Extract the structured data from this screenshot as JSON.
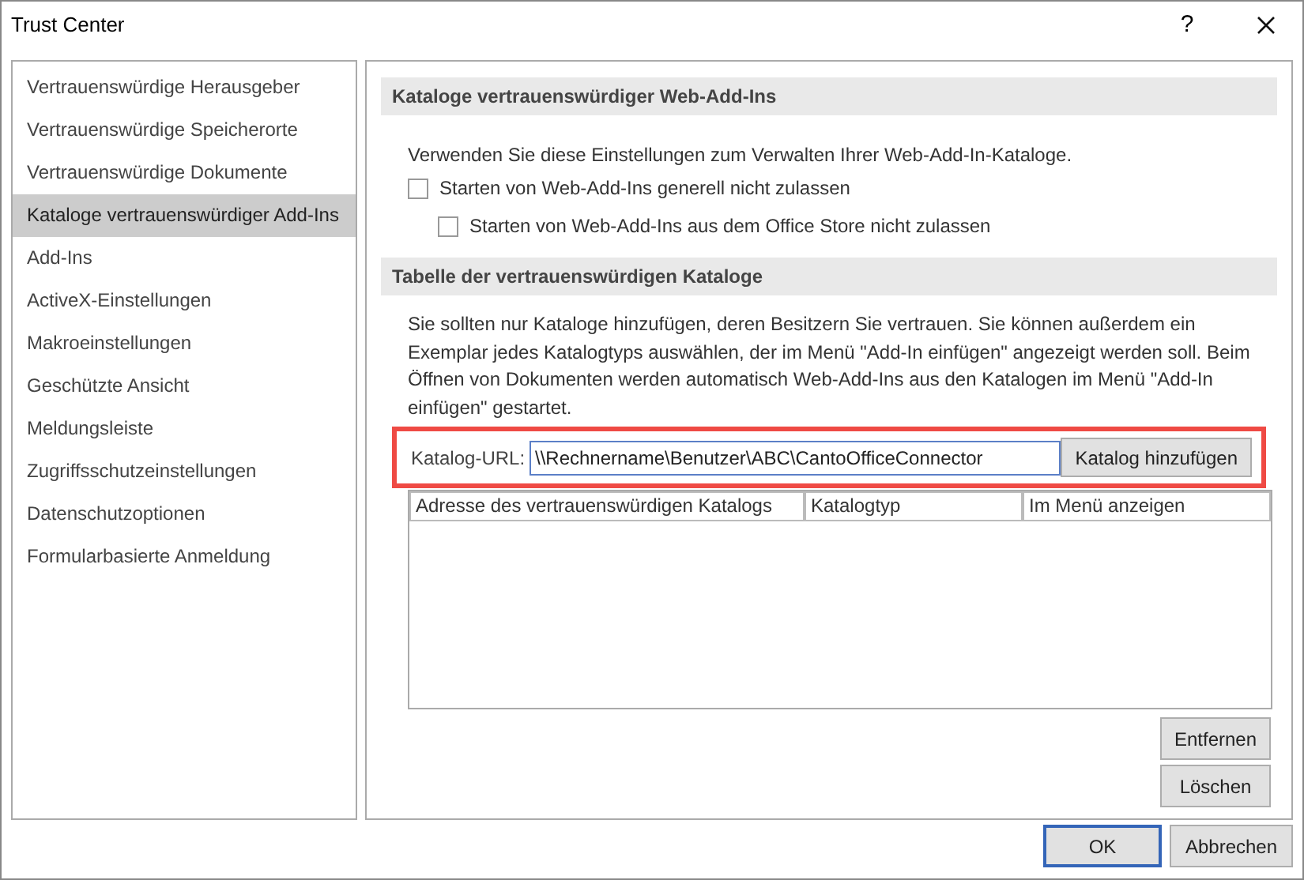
{
  "window": {
    "title": "Trust Center",
    "help": "?"
  },
  "sidebar": {
    "items": [
      {
        "label": "Vertrauenswürdige Herausgeber",
        "selected": false
      },
      {
        "label": "Vertrauenswürdige Speicherorte",
        "selected": false
      },
      {
        "label": "Vertrauenswürdige Dokumente",
        "selected": false
      },
      {
        "label": "Kataloge vertrauenswürdiger Add-Ins",
        "selected": true
      },
      {
        "label": "Add-Ins",
        "selected": false
      },
      {
        "label": "ActiveX-Einstellungen",
        "selected": false
      },
      {
        "label": "Makroeinstellungen",
        "selected": false
      },
      {
        "label": "Geschützte Ansicht",
        "selected": false
      },
      {
        "label": "Meldungsleiste",
        "selected": false
      },
      {
        "label": "Zugriffsschutzeinstellungen",
        "selected": false
      },
      {
        "label": "Datenschutzoptionen",
        "selected": false
      },
      {
        "label": "Formularbasierte Anmeldung",
        "selected": false
      }
    ]
  },
  "web_addins": {
    "heading": "Kataloge vertrauenswürdiger Web-Add-Ins",
    "description": "Verwenden Sie diese Einstellungen zum Verwalten Ihrer Web-Add-In-Kataloge.",
    "checkboxes": [
      {
        "label": "Starten von Web-Add-Ins generell nicht zulassen",
        "checked": false,
        "children": [
          {
            "label": "Starten von Web-Add-Ins aus dem Office Store nicht zulassen",
            "checked": false
          }
        ]
      }
    ]
  },
  "catalogs": {
    "heading": "Tabelle der vertrauenswürdigen Kataloge",
    "description": "Sie sollten nur Kataloge hinzufügen, deren Besitzern Sie vertrauen. Sie können außerdem ein Exemplar jedes Katalogtyps auswählen, der im Menü \"Add-In einfügen\" angezeigt werden soll. Beim Öffnen von Dokumenten werden automatisch Web-Add-Ins aus den Katalogen im Menü \"Add-In einfügen\" gestartet.",
    "url_label": "Katalog-URL:",
    "url_value": "\\\\Rechnername\\Benutzer\\ABC\\CantoOfficeConnector",
    "highlighted": true,
    "add_button": "Katalog hinzufügen",
    "table": {
      "columns": [
        "Adresse des vertrauenswürdigen Katalogs",
        "Katalogtyp",
        "Im Menü anzeigen"
      ]
    },
    "buttons": [
      "Entfernen",
      "Löschen"
    ]
  },
  "footer": {
    "buttons": [
      {
        "label": "OK",
        "default": true
      },
      {
        "label": "Abbrechen",
        "default": false
      }
    ]
  }
}
